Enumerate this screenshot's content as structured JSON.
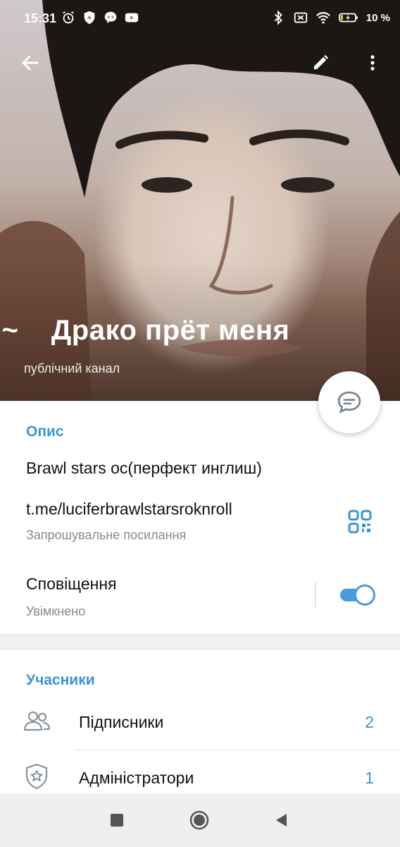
{
  "status_bar": {
    "time": "15:31",
    "battery_percent": "10 %",
    "icons": [
      "alarm-icon",
      "shield-icon",
      "messenger-icon",
      "youtube-icon",
      "bluetooth-icon",
      "no-sim-icon",
      "wifi-icon",
      "battery-charging-icon"
    ]
  },
  "header": {
    "title": "гол~    Драко прёт меня",
    "subtitle": "публічний канал",
    "toolbar": [
      "back-arrow-icon",
      "pencil-icon",
      "more-vertical-icon"
    ]
  },
  "description": {
    "heading": "Опис",
    "text": "Brawl stars ос(перфект инглиш)",
    "link": "t.me/luciferbrawlstarsroknroll",
    "link_caption": "Запрошувальне посилання"
  },
  "notifications": {
    "label": "Сповіщення",
    "status": "Увімкнено",
    "enabled": true
  },
  "members": {
    "heading": "Учасники",
    "rows": [
      {
        "label": "Підписники",
        "count": "2",
        "icon": "people-icon"
      },
      {
        "label": "Адміністратори",
        "count": "1",
        "icon": "admin-shield-icon"
      }
    ]
  },
  "colors": {
    "accent": "#3a95d5",
    "toggle": "#4a9bdb",
    "nav_background": "#efefef"
  }
}
